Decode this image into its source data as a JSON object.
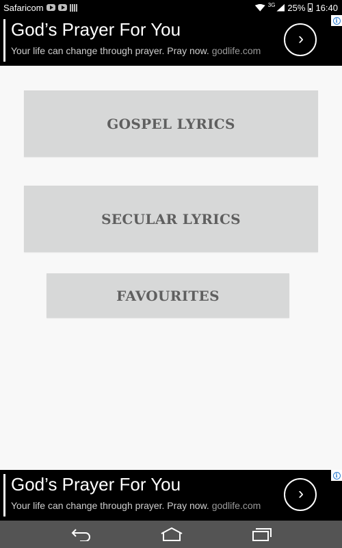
{
  "status_bar": {
    "carrier": "Safaricom",
    "network_type": "3G",
    "battery": "25%",
    "time": "16:40"
  },
  "ad_top": {
    "title": "God’s Prayer For You",
    "subtitle": "Your life can change through prayer. Pray now.",
    "domain": "godlife.com",
    "arrow": "›"
  },
  "menu": {
    "gospel_label": "GOSPEL LYRICS",
    "secular_label": "SECULAR LYRICS",
    "favourites_label": "FAVOURITES"
  },
  "ad_bottom": {
    "title": "God’s Prayer For You",
    "subtitle": "Your life can change through prayer. Pray now.",
    "domain": "godlife.com",
    "arrow": "›"
  },
  "nav_bar": {
    "back_icon": "back-icon",
    "home_icon": "home-icon",
    "recent_icon": "recent-apps-icon"
  },
  "colors": {
    "button_bg": "#d7d8d8",
    "button_text": "#5f5f5f",
    "background": "#f8f8f8",
    "ad_bg": "#000000",
    "nav_bg": "#545454"
  }
}
